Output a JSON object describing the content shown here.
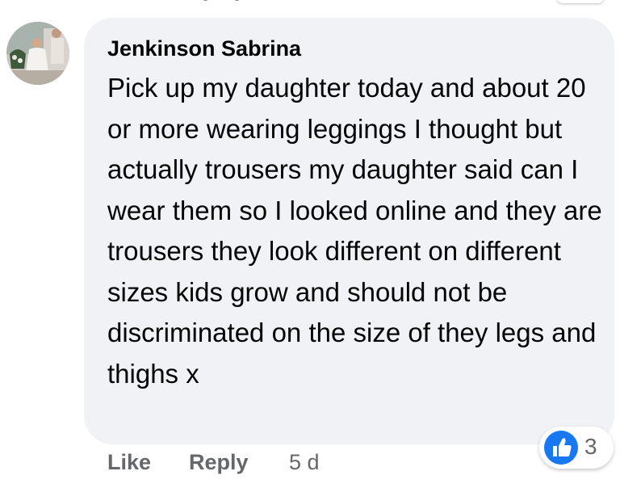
{
  "comment": {
    "author": "Jenkinson Sabrina",
    "text": "Pick up my daughter today and about 20 or more wearing leggings I thought but actually trousers my daughter said can I wear them so I looked online and they are trousers they look different on different sizes kids grow and should not be discriminated on the size of they legs and thighs x",
    "reaction_icon": "like-icon",
    "reaction_count": "3",
    "timestamp": "5 d"
  },
  "actions": {
    "like_label": "Like",
    "reply_label": "Reply"
  },
  "colors": {
    "bubble": "#f0f2f5",
    "text": "#050505",
    "secondary_text": "#65676b",
    "like_blue": "#1877f2"
  }
}
